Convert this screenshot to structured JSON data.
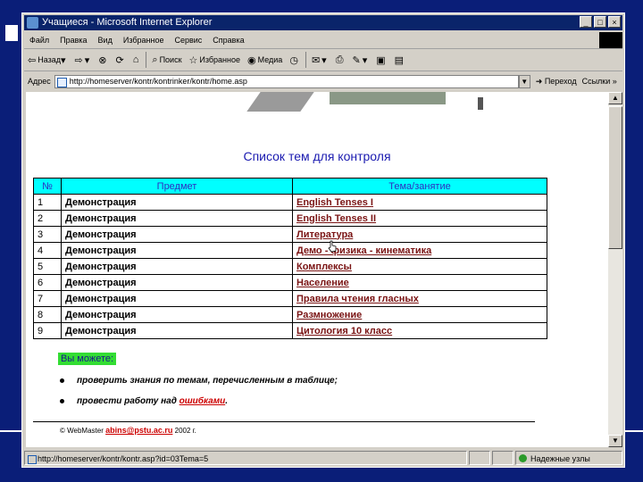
{
  "window": {
    "title": "Учащиеся - Microsoft Internet Explorer",
    "buttons": {
      "minimize": "_",
      "maximize": "□",
      "close": "×"
    }
  },
  "menu": [
    "Файл",
    "Правка",
    "Вид",
    "Избранное",
    "Сервис",
    "Справка"
  ],
  "toolbar": {
    "back": "Назад",
    "search": "Поиск",
    "favorites": "Избранное",
    "media": "Медиа"
  },
  "address": {
    "label": "Адрес",
    "value": "http://homeserver/kontr/kontrinker/kontr/home.asp",
    "go": "Переход",
    "links": "Ссылки"
  },
  "page": {
    "title": "Список тем для контроля",
    "table": {
      "headers": [
        "№",
        "Предмет",
        "Тема/занятие"
      ],
      "rows": [
        {
          "num": "1",
          "subject": "Демонстрация",
          "topic": "English Tenses I"
        },
        {
          "num": "2",
          "subject": "Демонстрация",
          "topic": "English Tenses II"
        },
        {
          "num": "3",
          "subject": "Демонстрация",
          "topic": "Литература"
        },
        {
          "num": "4",
          "subject": "Демонстрация",
          "topic": "Демо - физика - кинематика"
        },
        {
          "num": "5",
          "subject": "Демонстрация",
          "topic": "Комплексы"
        },
        {
          "num": "6",
          "subject": "Демонстрация",
          "topic": "Население"
        },
        {
          "num": "7",
          "subject": "Демонстрация",
          "topic": "Правила чтения гласных"
        },
        {
          "num": "8",
          "subject": "Демонстрация",
          "topic": "Размножение"
        },
        {
          "num": "9",
          "subject": "Демонстрация",
          "topic": "Цитология 10 класс"
        }
      ]
    },
    "you_can": "Вы можете:",
    "bullets": {
      "first": "проверить знания по темам, перечисленным в таблице;",
      "second_prefix": "провести работу над",
      "second_link": "ошибками",
      "second_suffix": "."
    },
    "footer": {
      "prefix": "© WebMaster",
      "email": "abins@pstu.ac.ru",
      "year": "2002 г."
    }
  },
  "status": {
    "url": "http://homeserver/kontr/kontr.asp?id=03Tema=5",
    "zone": "Надежные узлы"
  }
}
